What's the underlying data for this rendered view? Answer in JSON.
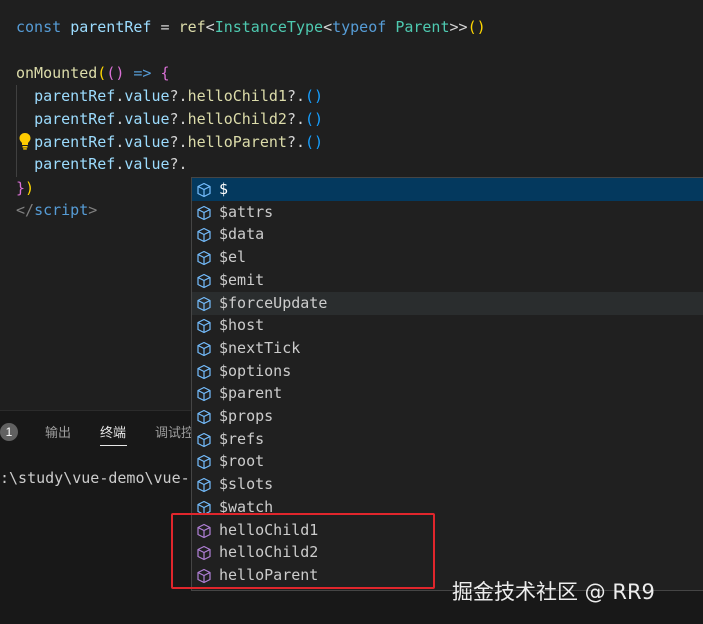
{
  "editor": {
    "lines": [
      {
        "t": [
          [
            "const ",
            "kw"
          ],
          [
            "parentRef",
            "var"
          ],
          [
            " = ",
            "op"
          ],
          [
            "ref",
            "fn"
          ],
          [
            "<",
            "op"
          ],
          [
            "InstanceType",
            "type"
          ],
          [
            "<",
            "op"
          ],
          [
            "typeof ",
            "kw"
          ],
          [
            "Parent",
            "type"
          ],
          [
            ">>",
            "op"
          ],
          [
            "()",
            "b1"
          ]
        ]
      },
      {
        "t": []
      },
      {
        "t": [
          [
            "onMounted",
            "fn"
          ],
          [
            "(",
            "b1"
          ],
          [
            "()",
            "b2"
          ],
          [
            " => ",
            "kw"
          ],
          [
            "{",
            "b2"
          ]
        ]
      },
      {
        "t": [
          [
            "  ",
            "op"
          ],
          [
            "parentRef",
            "var"
          ],
          [
            ".",
            "op"
          ],
          [
            "value",
            "var"
          ],
          [
            "?.",
            "op"
          ],
          [
            "helloChild1",
            "fn"
          ],
          [
            "?.",
            "op"
          ],
          [
            "()",
            "b3"
          ]
        ]
      },
      {
        "t": [
          [
            "  ",
            "op"
          ],
          [
            "parentRef",
            "var"
          ],
          [
            ".",
            "op"
          ],
          [
            "value",
            "var"
          ],
          [
            "?.",
            "op"
          ],
          [
            "helloChild2",
            "fn"
          ],
          [
            "?.",
            "op"
          ],
          [
            "()",
            "b3"
          ]
        ]
      },
      {
        "t": [
          [
            "  ",
            "op"
          ],
          [
            "parentRef",
            "var"
          ],
          [
            ".",
            "op"
          ],
          [
            "value",
            "var"
          ],
          [
            "?.",
            "op"
          ],
          [
            "helloParent",
            "fn"
          ],
          [
            "?.",
            "op"
          ],
          [
            "()",
            "b3"
          ]
        ]
      },
      {
        "t": [
          [
            "  ",
            "op"
          ],
          [
            "parentRef",
            "var"
          ],
          [
            ".",
            "op"
          ],
          [
            "value",
            "var"
          ],
          [
            "?.",
            "op"
          ]
        ]
      },
      {
        "t": [
          [
            "}",
            "b2"
          ],
          [
            ")",
            "b1"
          ]
        ]
      },
      {
        "t": [
          [
            "</",
            "tag"
          ],
          [
            "script",
            "tagname"
          ],
          [
            ">",
            "tag"
          ]
        ]
      }
    ]
  },
  "panel": {
    "badge": "1",
    "tabs": [
      "输出",
      "终端",
      "调试控"
    ],
    "active_tab": "终端",
    "terminal_text": ":\\study\\vue-demo\\vue-s"
  },
  "suggest": {
    "items": [
      {
        "label": "$",
        "kind": "property",
        "state": "selected"
      },
      {
        "label": "$attrs",
        "kind": "property"
      },
      {
        "label": "$data",
        "kind": "property"
      },
      {
        "label": "$el",
        "kind": "property"
      },
      {
        "label": "$emit",
        "kind": "property"
      },
      {
        "label": "$forceUpdate",
        "kind": "property",
        "state": "hover"
      },
      {
        "label": "$host",
        "kind": "property"
      },
      {
        "label": "$nextTick",
        "kind": "property"
      },
      {
        "label": "$options",
        "kind": "property"
      },
      {
        "label": "$parent",
        "kind": "property"
      },
      {
        "label": "$props",
        "kind": "property"
      },
      {
        "label": "$refs",
        "kind": "property"
      },
      {
        "label": "$root",
        "kind": "property"
      },
      {
        "label": "$slots",
        "kind": "property"
      },
      {
        "label": "$watch",
        "kind": "property"
      },
      {
        "label": "helloChild1",
        "kind": "method"
      },
      {
        "label": "helloChild2",
        "kind": "method"
      },
      {
        "label": "helloParent",
        "kind": "method"
      }
    ],
    "property_color": "#75beff",
    "method_color": "#b180d7",
    "highlight_color": "#e0262c"
  },
  "watermark": "掘金技术社区 @ RR9"
}
